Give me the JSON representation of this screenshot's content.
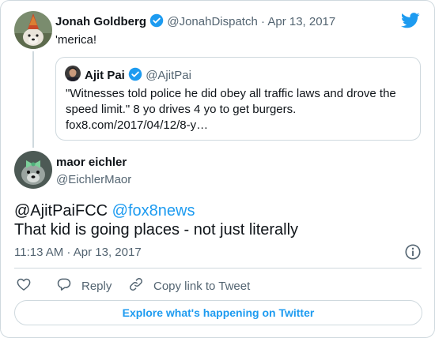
{
  "parent": {
    "name": "Jonah Goldberg",
    "handle": "@JonahDispatch",
    "separator": "·",
    "date": "Apr 13, 2017",
    "text": "'merica!",
    "avatar_icon": "dog-in-party-hat-avatar"
  },
  "quoted": {
    "name": "Ajit Pai",
    "handle": "@AjitPai",
    "text": "\"Witnesses told police he did obey all traffic laws and drove the speed limit.\" 8 yo drives 4 yo to get burgers. fox8.com/2017/04/12/8-y…",
    "avatar_icon": "man-portrait-avatar"
  },
  "tweet": {
    "name": "maor eichler",
    "handle": "@EichlerMaor",
    "mention1": "@AjitPaiFCC",
    "mention2": "@fox8news",
    "line2": "That kid is going places - not just literally",
    "timestamp": "11:13 AM · Apr 13, 2017",
    "avatar_icon": "dog-with-bow-avatar"
  },
  "actions": {
    "like_icon": "heart-icon",
    "reply_label": "Reply",
    "copy_label": "Copy link to Tweet"
  },
  "footer": {
    "explore_label": "Explore what's happening on Twitter"
  },
  "colors": {
    "accent": "#1d9bf0",
    "muted": "#536471",
    "border": "#cfd9de",
    "text": "#0f1419"
  }
}
